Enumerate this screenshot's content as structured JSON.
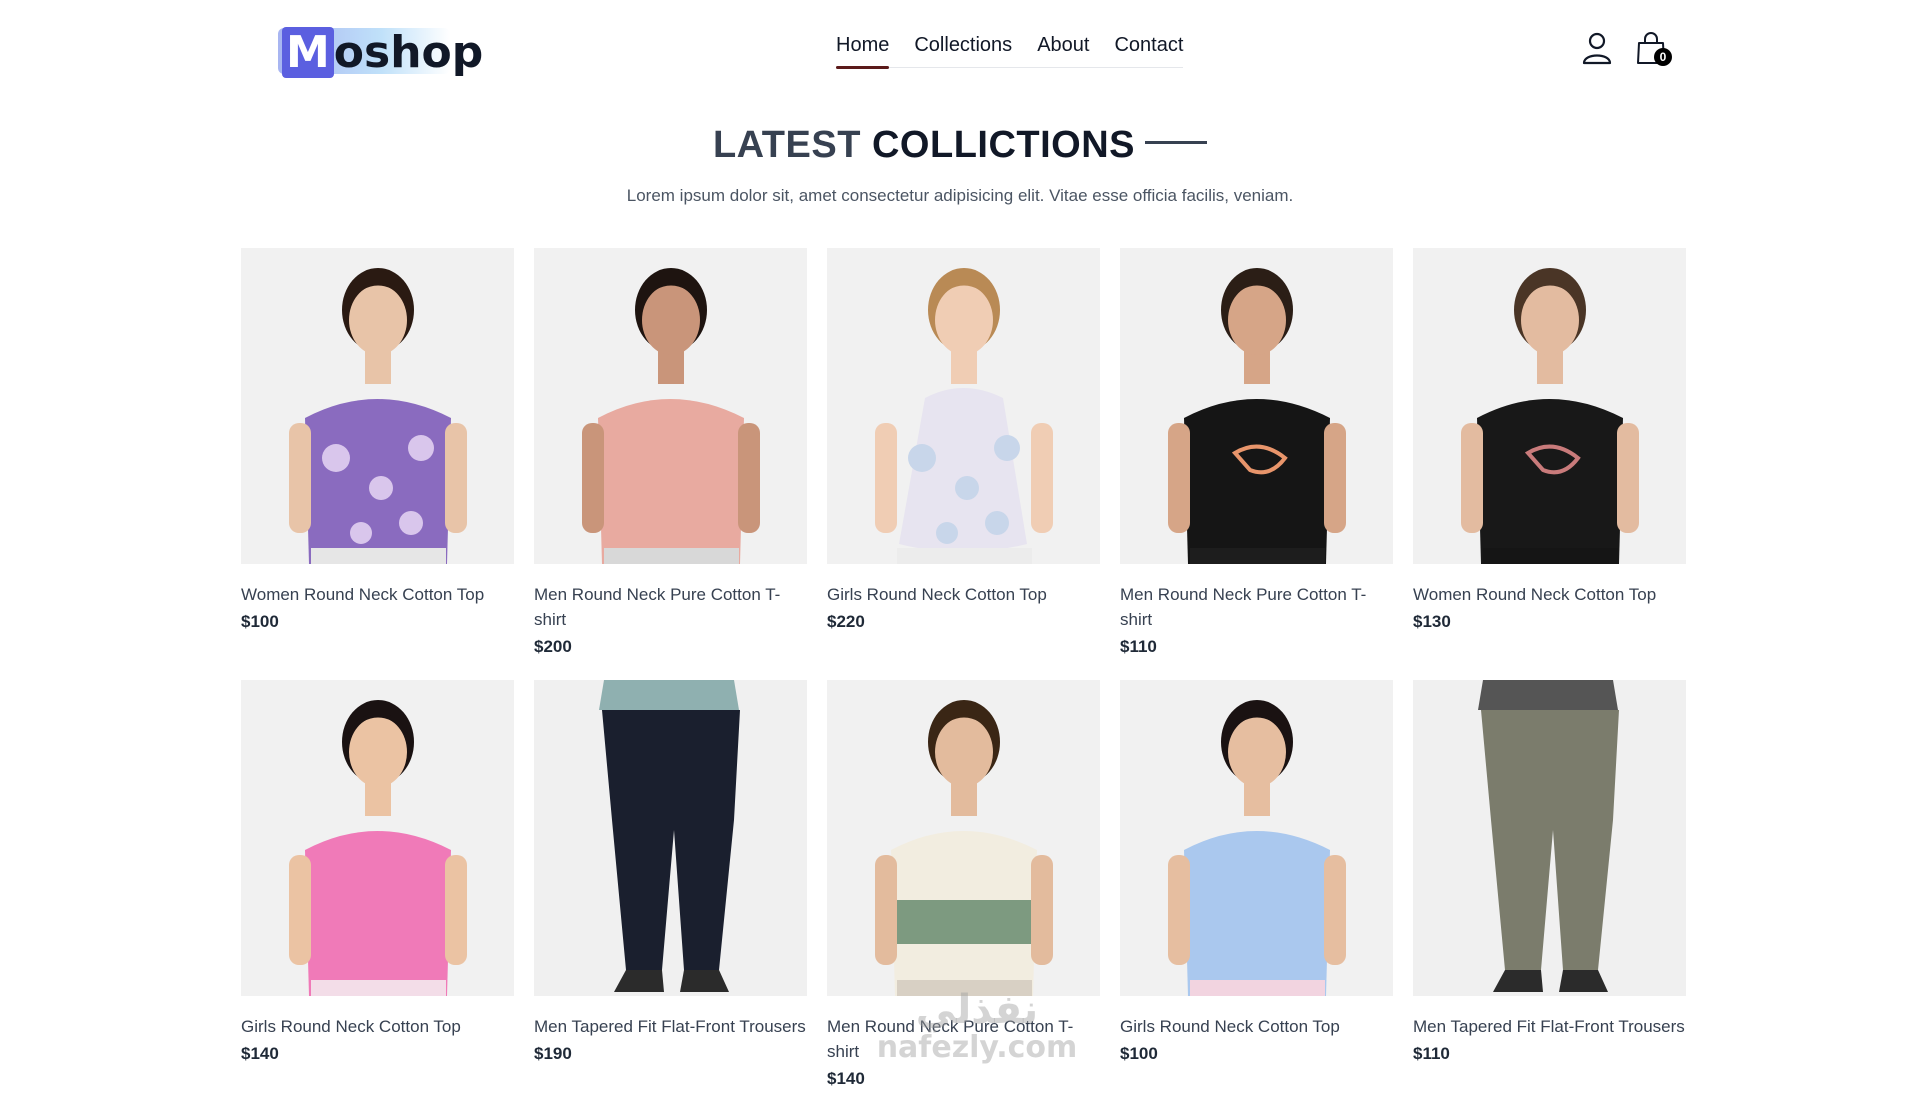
{
  "header": {
    "logo_text": "oshop",
    "logo_letter": "M",
    "nav": [
      "Home",
      "Collections",
      "About",
      "Contact"
    ],
    "active_nav": "Home",
    "cart_count": "0"
  },
  "section": {
    "title_light": "LATEST ",
    "title_bold": "COLLICTIONS",
    "subtitle": "Lorem ipsum dolor sit, amet consectetur adipisicing elit. Vitae esse officia facilis, veniam."
  },
  "products": [
    {
      "name": "Women Round Neck Cotton Top",
      "price": "$100",
      "figure": "woman-floral-top"
    },
    {
      "name": "Men Round Neck Pure Cotton T-shirt",
      "price": "$200",
      "figure": "man-pink-polo"
    },
    {
      "name": "Girls Round Neck Cotton Top",
      "price": "$220",
      "figure": "girl-floral-dress"
    },
    {
      "name": "Men Round Neck Pure Cotton T-shirt",
      "price": "$110",
      "figure": "man-black-tee"
    },
    {
      "name": "Women Round Neck Cotton Top",
      "price": "$130",
      "figure": "woman-black-tee"
    },
    {
      "name": "Girls Round Neck Cotton Top",
      "price": "$140",
      "figure": "girl-pink-top"
    },
    {
      "name": "Men Tapered Fit Flat-Front Trousers",
      "price": "$190",
      "figure": "man-navy-trousers"
    },
    {
      "name": "Men Round Neck Pure Cotton T-shirt",
      "price": "$140",
      "figure": "man-striped-sweatshirt"
    },
    {
      "name": "Girls Round Neck Cotton Top",
      "price": "$100",
      "figure": "girl-blue-top"
    },
    {
      "name": "Men Tapered Fit Flat-Front Trousers",
      "price": "$110",
      "figure": "man-grey-cargo"
    }
  ],
  "watermark": {
    "arabic": "نفذلي",
    "latin": "nafezly.com"
  },
  "colors": {
    "accent_underline": "#5b1a1a",
    "logo_m_bg": "#5b5fe0",
    "image_bg": "#f1f1f1"
  }
}
